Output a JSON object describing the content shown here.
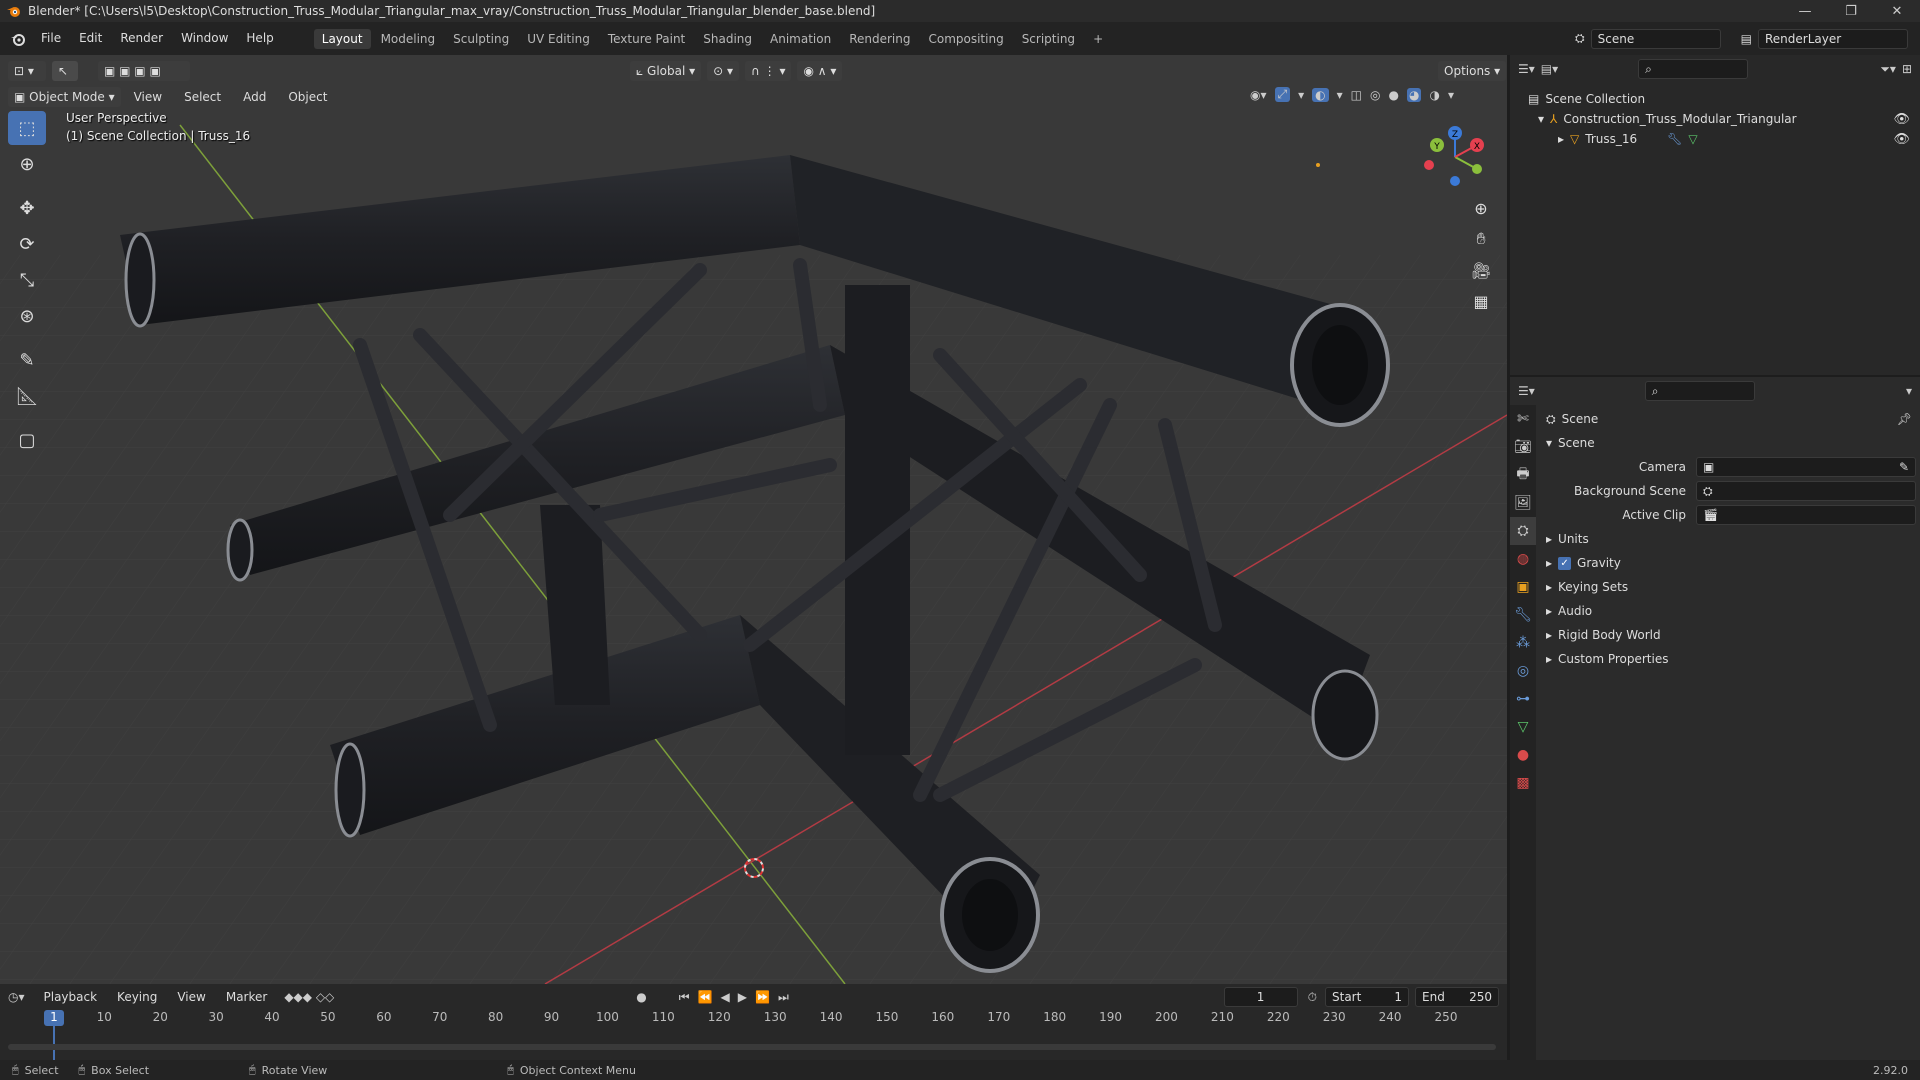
{
  "window": {
    "title": "Blender* [C:\\Users\\l5\\Desktop\\Construction_Truss_Modular_Triangular_max_vray/Construction_Truss_Modular_Triangular_blender_base.blend]",
    "minimize": "—",
    "restore": "❐",
    "close": "✕"
  },
  "menu": [
    "File",
    "Edit",
    "Render",
    "Window",
    "Help"
  ],
  "workspaces": [
    "Layout",
    "Modeling",
    "Sculpting",
    "UV Editing",
    "Texture Paint",
    "Shading",
    "Animation",
    "Rendering",
    "Compositing",
    "Scripting"
  ],
  "active_workspace": "Layout",
  "add_workspace": "+",
  "scene_field": "Scene",
  "render_layer_field": "RenderLayer",
  "viewport": {
    "mode": "Object Mode",
    "menus": [
      "View",
      "Select",
      "Add",
      "Object"
    ],
    "orientation": "Global",
    "options": "Options",
    "perspective": "User Perspective",
    "collection_info": "(1) Scene Collection | Truss_16",
    "axes": {
      "x": "X",
      "y": "Y",
      "z": "Z"
    }
  },
  "outliner": {
    "root": "Scene Collection",
    "collection": "Construction_Truss_Modular_Triangular",
    "object": "Truss_16"
  },
  "properties": {
    "header": "Scene",
    "panel": "Scene",
    "camera_label": "Camera",
    "background_label": "Background Scene",
    "clip_label": "Active Clip",
    "sections": [
      "Units",
      "Gravity",
      "Keying Sets",
      "Audio",
      "Rigid Body World",
      "Custom Properties"
    ],
    "gravity_enabled": true
  },
  "timeline": {
    "menus": [
      "Playback",
      "Keying",
      "View",
      "Marker"
    ],
    "current_frame": "1",
    "start_label": "Start",
    "start": "1",
    "end_label": "End",
    "end": "250",
    "ticks": [
      "1",
      "10",
      "20",
      "30",
      "40",
      "50",
      "60",
      "70",
      "80",
      "90",
      "100",
      "110",
      "120",
      "130",
      "140",
      "150",
      "160",
      "170",
      "180",
      "190",
      "200",
      "210",
      "220",
      "230",
      "240",
      "250"
    ]
  },
  "status": {
    "select": "Select",
    "box_select": "Box Select",
    "rotate": "Rotate View",
    "context": "Object Context Menu",
    "version": "2.92.0"
  },
  "colors": {
    "accent": "#4772b3",
    "x_axis": "#e5404f",
    "y_axis": "#8bbf3c",
    "z_axis": "#3b7ad8"
  }
}
